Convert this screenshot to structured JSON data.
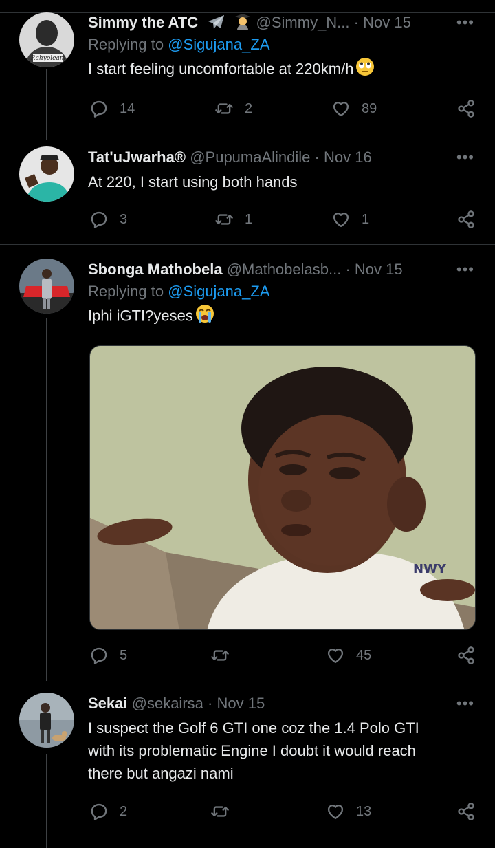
{
  "tweets": [
    {
      "name": "Simmy the ATC",
      "handle": "@Simmy_N...",
      "date": "Nov 15",
      "replying_prefix": "Replying to ",
      "replying_to": "@Sigujana_ZA",
      "text": "I start feeling uncomfortable at 220km/h",
      "avatar_text": "Rahyoleam",
      "emoji_icons": [
        "airplane-emoji-icon",
        "student-emoji-icon",
        "eyes-rolling-emoji-icon"
      ],
      "replies": "14",
      "retweets": "2",
      "likes": "89"
    },
    {
      "name": "Tat'uJwarha®",
      "handle": "@PupumaAlindile",
      "date": "Nov 16",
      "text": "At 220, I start using both hands",
      "replies": "3",
      "retweets": "1",
      "likes": "1"
    },
    {
      "name": "Sbonga Mathobela",
      "handle": "@Mathobelasb...",
      "date": "Nov 15",
      "replying_prefix": "Replying to ",
      "replying_to": "@Sigujana_ZA",
      "text": "Iphi iGTI?yeses",
      "emoji_icons": [
        "loudly-crying-emoji-icon"
      ],
      "media_shirt_text": "NWY",
      "replies": "5",
      "likes": "45"
    },
    {
      "name": "Sekai",
      "handle": "@sekairsa",
      "date": "Nov 15",
      "text_lines": [
        "I suspect the Golf 6 GTI one coz the 1.4 Polo GTI",
        "with its problematic Engine I doubt it would reach",
        "there but angazi nami"
      ],
      "replies": "2",
      "likes": "13"
    }
  ],
  "separator": "·",
  "more_label": "•••",
  "icons": [
    "reply-icon",
    "retweet-icon",
    "like-icon",
    "share-icon",
    "more-icon"
  ],
  "colors": {
    "background": "#000000",
    "text": "#e7e9ea",
    "muted": "#71767b",
    "link": "#1d9bf0",
    "divider": "#2f3336"
  }
}
